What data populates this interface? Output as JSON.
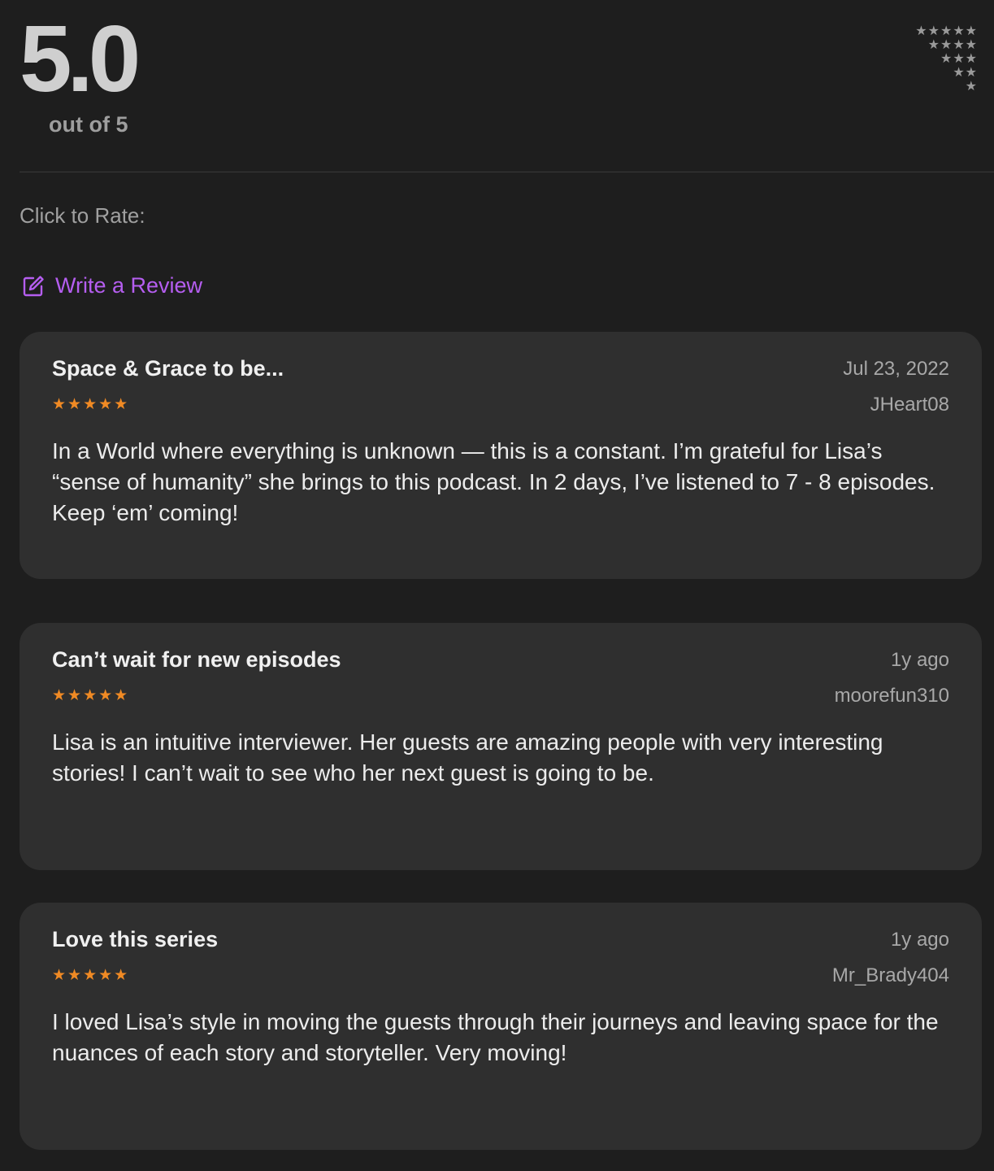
{
  "summary": {
    "average": "5.0",
    "out_of": "out of 5",
    "histogram_rows": [
      "★★★★★",
      "★★★★",
      "★★★",
      "★★",
      "★"
    ]
  },
  "rate": {
    "label": "Click to Rate:"
  },
  "write_review": {
    "label": "Write a Review",
    "icon": "compose-icon",
    "accent": "#b55ef0"
  },
  "colors": {
    "background": "#1e1e1e",
    "card": "#2f2f2f",
    "star": "#f08a24"
  },
  "reviews": [
    {
      "title": "Space & Grace to be...",
      "date": "Jul 23, 2022",
      "author": "JHeart08",
      "stars": "★★★★★",
      "rating": 5,
      "body": "In a World where everything is unknown — this is a constant. I’m grateful for Lisa’s “sense of humanity” she brings to this podcast. In 2 days, I’ve listened to 7 - 8 episodes. Keep ‘em’ coming!"
    },
    {
      "title": "Can’t wait for new episodes",
      "date": "1y ago",
      "author": "moorefun310",
      "stars": "★★★★★",
      "rating": 5,
      "body": "Lisa is an intuitive interviewer.  Her guests are amazing people with very interesting stories!  I can’t wait to see who her next guest is going to be."
    },
    {
      "title": "Love this series",
      "date": "1y ago",
      "author": "Mr_Brady404",
      "stars": "★★★★★",
      "rating": 5,
      "body": "I loved Lisa’s style in moving the guests through their journeys and leaving space for the nuances of each story and storyteller. Very moving!"
    }
  ]
}
